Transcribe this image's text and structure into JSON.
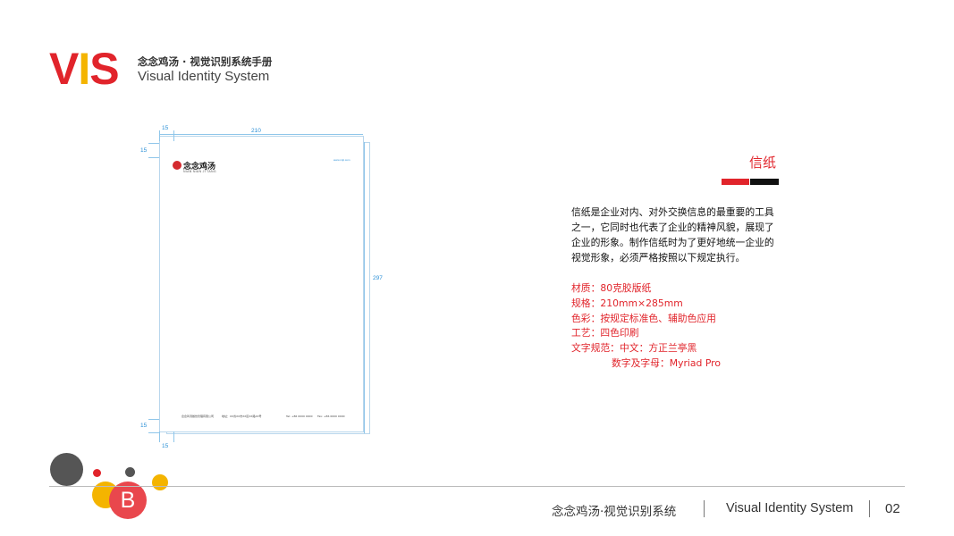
{
  "header": {
    "logo": {
      "v": "V",
      "i": "I",
      "s": "S"
    },
    "title_cn": "念念鸡汤 · 视觉识别系统手册",
    "title_en": "Visual Identity System"
  },
  "mockup": {
    "dim_width": "210",
    "dim_height": "297",
    "dim_margin_top": "15",
    "dim_margin_left": "15",
    "dim_margin_bottom_left": "15",
    "dim_margin_bottom": "15",
    "letterhead_name": "念念鸡汤",
    "letterhead_sub": "NIAN NIAN JI TANG",
    "letterhead_web": "www.nnjt.com",
    "footer_company": "念念鸡汤餐饮管理有限公司",
    "footer_address": "地址：XX省XX市XX区XX路XX号",
    "footer_tel": "Tel: +86 0000 0000",
    "footer_fax": "Fax: +86 0000 0000"
  },
  "section": {
    "title": "信纸",
    "description": "信纸是企业对内、对外交换信息的最重要的工具之一，它同时也代表了企业的精神风貌，展现了企业的形象。制作信纸时为了更好地统一企业的视觉形象，必须严格按照以下规定执行。",
    "specs": [
      "材质：80克胶版纸",
      "规格：210mm×285mm",
      "色彩：按规定标准色、辅助色应用",
      "工艺：四色印刷",
      "文字规范：中文：方正兰亭黑",
      "数字及字母：Myriad Pro"
    ]
  },
  "decor": {
    "badge_letter": "B"
  },
  "footer": {
    "title_cn": "念念鸡汤·视觉识别系统",
    "title_en": "Visual Identity System",
    "page": "02"
  },
  "colors": {
    "brand_red": "#e1242b",
    "brand_yellow": "#f4b400",
    "dark": "#111111"
  }
}
